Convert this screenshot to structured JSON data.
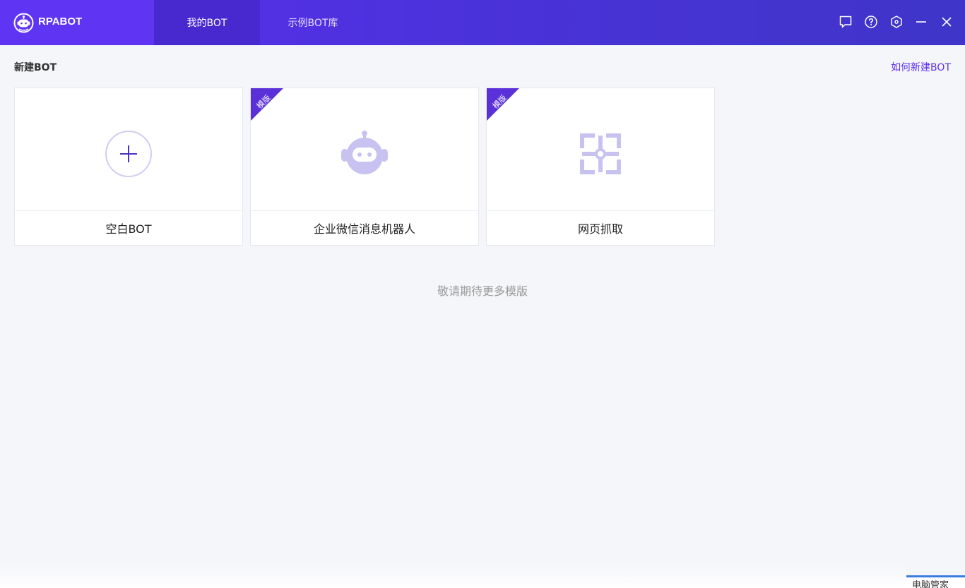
{
  "app": {
    "name": "RPABOT",
    "brand_color": "#5b2ff0"
  },
  "tabs": [
    {
      "label": "我的BOT",
      "active": true
    },
    {
      "label": "示例BOT库",
      "active": false
    }
  ],
  "window_controls": [
    {
      "icon": "chat-bubble-icon"
    },
    {
      "icon": "help-circle-icon"
    },
    {
      "icon": "settings-hexagon-icon"
    },
    {
      "icon": "minimize-icon"
    },
    {
      "icon": "close-icon"
    }
  ],
  "main": {
    "section_title": "新建BOT",
    "help_link": "如何新建BOT",
    "cards": [
      {
        "label": "空白BOT",
        "icon": "plus-circle-icon",
        "ribbon": ""
      },
      {
        "label": "企业微信消息机器人",
        "icon": "robot-icon",
        "ribbon": "模版"
      },
      {
        "label": "网页抓取",
        "icon": "web-scrape-icon",
        "ribbon": "模版"
      }
    ],
    "coming_soon": "敬请期待更多模版"
  },
  "taskbar": {
    "label": "电脑管家"
  }
}
